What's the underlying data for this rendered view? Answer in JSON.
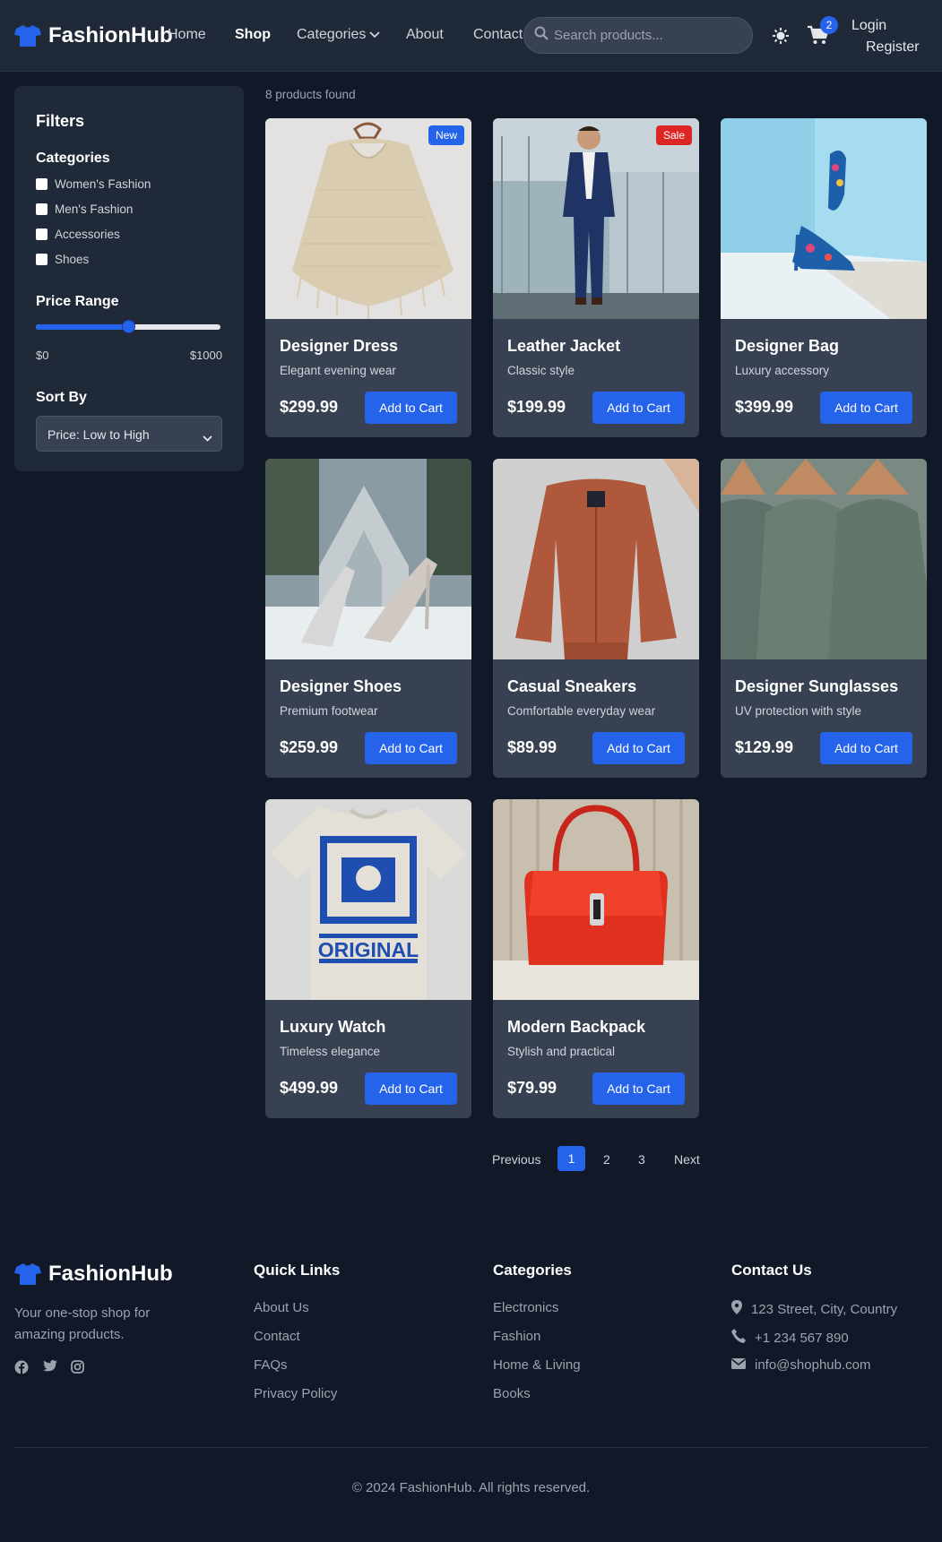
{
  "brand": {
    "name": "FashionHub",
    "accent": "#2563eb"
  },
  "nav": {
    "links": [
      "Home",
      "Shop",
      "Categories",
      "About",
      "Contact"
    ],
    "active": "Shop"
  },
  "search": {
    "placeholder": "Search products..."
  },
  "cart": {
    "count": "2"
  },
  "auth": {
    "login": "Login",
    "register": "Register"
  },
  "sidebar": {
    "title": "Filters",
    "categories_title": "Categories",
    "categories": [
      "Women's Fashion",
      "Men's Fashion",
      "Accessories",
      "Shoes"
    ],
    "price_title": "Price Range",
    "price_min": "$0",
    "price_max": "$1000",
    "price_value_fraction": 0.5,
    "sort_title": "Sort By",
    "sort_selected": "Price: Low to High"
  },
  "results": {
    "count_text": "8 products found"
  },
  "products": [
    {
      "name": "Designer Dress",
      "desc": "Elegant evening wear",
      "price": "$299.99",
      "badge": "New",
      "image": "knit-poncho-on-hanger"
    },
    {
      "name": "Leather Jacket",
      "desc": "Classic style",
      "price": "$199.99",
      "badge": "Sale",
      "image": "man-in-navy-suit"
    },
    {
      "name": "Designer Bag",
      "desc": "Luxury accessory",
      "price": "$399.99",
      "badge": "",
      "image": "floral-high-heels"
    },
    {
      "name": "Designer Shoes",
      "desc": "Premium footwear",
      "price": "$259.99",
      "badge": "",
      "image": "glitter-heels-snow"
    },
    {
      "name": "Casual Sneakers",
      "desc": "Comfortable everyday wear",
      "price": "$89.99",
      "badge": "",
      "image": "rust-bomber-jacket"
    },
    {
      "name": "Designer Sunglasses",
      "desc": "UV protection with style",
      "price": "$129.99",
      "badge": "",
      "image": "green-shirts-on-hangers"
    },
    {
      "name": "Luxury Watch",
      "desc": "Timeless elegance",
      "price": "$499.99",
      "badge": "",
      "image": "original-graphic-tshirt"
    },
    {
      "name": "Modern Backpack",
      "desc": "Stylish and practical",
      "price": "$79.99",
      "badge": "",
      "image": "red-handbag"
    }
  ],
  "add_to_cart_label": "Add to Cart",
  "image_texts": {
    "tshirt_print": "ORIGINAL"
  },
  "pagination": {
    "previous": "Previous",
    "pages": [
      "1",
      "2",
      "3"
    ],
    "current": "1",
    "next": "Next"
  },
  "footer": {
    "tagline": "Your one-stop shop for amazing products.",
    "social": [
      "facebook-icon",
      "twitter-icon",
      "instagram-icon"
    ],
    "quick_links_title": "Quick Links",
    "quick_links": [
      "About Us",
      "Contact",
      "FAQs",
      "Privacy Policy"
    ],
    "categories_title": "Categories",
    "categories": [
      "Electronics",
      "Fashion",
      "Home & Living",
      "Books"
    ],
    "contact_title": "Contact Us",
    "address": "123 Street, City, Country",
    "phone": "+1 234 567 890",
    "email": "info@shophub.com",
    "copyright": "© 2024 FashionHub. All rights reserved."
  }
}
